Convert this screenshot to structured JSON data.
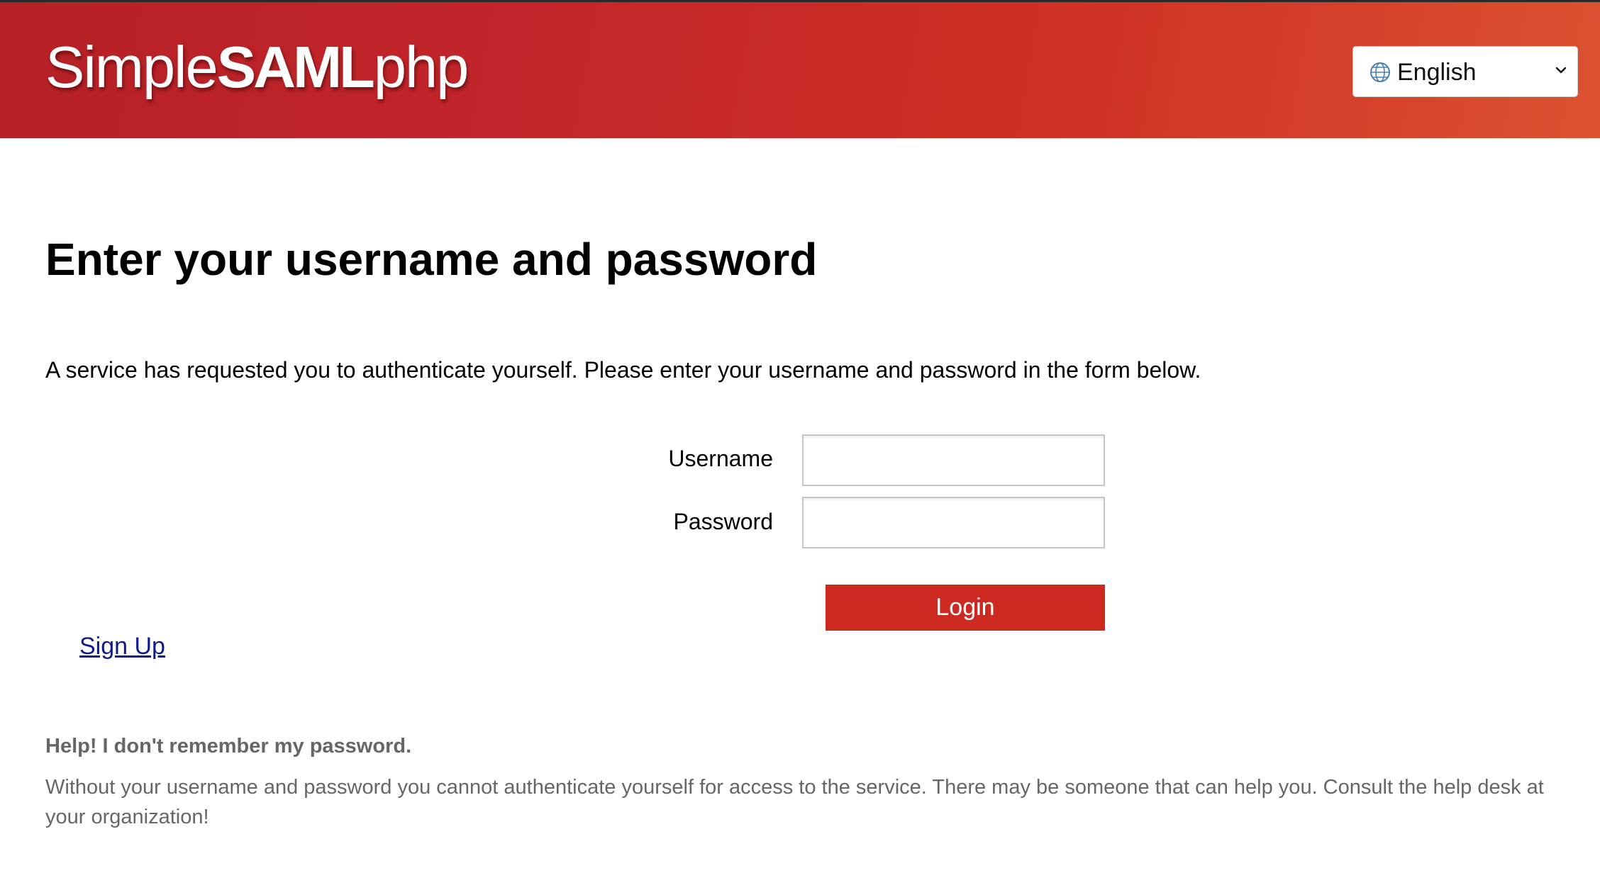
{
  "header": {
    "logo": {
      "part1": "Simple",
      "part2": "SAML",
      "part3": "php"
    },
    "language": {
      "icon": "globe-icon",
      "selected": "English",
      "dropdown_icon": "chevron-down-icon"
    }
  },
  "main": {
    "title": "Enter your username and password",
    "intro": "A service has requested you to authenticate yourself. Please enter your username and password in the form below.",
    "form": {
      "username_label": "Username",
      "username_value": "",
      "password_label": "Password",
      "password_value": "",
      "login_label": "Login"
    },
    "signup_link": "Sign Up",
    "help": {
      "title": "Help! I don't remember my password.",
      "text": "Without your username and password you cannot authenticate yourself for access to the service. There may be someone that can help you. Consult the help desk at your organization!"
    }
  },
  "colors": {
    "header_start": "#b52126",
    "header_end": "#dc5230",
    "button": "#cc2a20",
    "link": "#0f1a8a",
    "help_text": "#666666"
  }
}
